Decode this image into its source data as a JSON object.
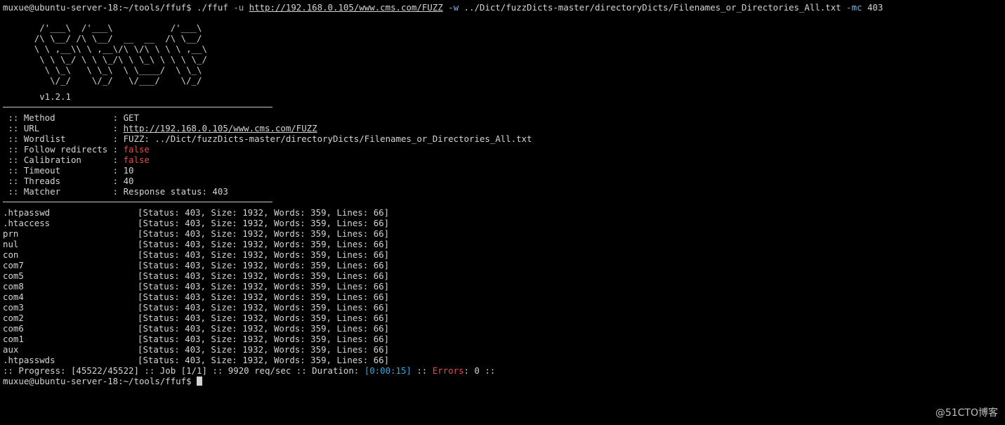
{
  "command": {
    "prompt": "muxue@ubuntu-server-18:~/tools/ffuf$",
    "exe": "./ffuf",
    "flag_u": "-u",
    "url": "http://192.168.0.105/www.cms.com/FUZZ",
    "flag_w": "-w",
    "wordlist": "../Dict/fuzzDicts-master/directoryDicts/Filenames_or_Directories_All.txt",
    "flag_mc": "-mc",
    "mc_value": "403"
  },
  "banner": {
    "art": [
      "       /'___\\  /'___\\           /'___\\",
      "      /\\ \\__/ /\\ \\__/  __  __  /\\ \\__/",
      "      \\ \\ ,__\\\\ \\ ,__\\/\\ \\/\\ \\ \\ \\ ,__\\",
      "       \\ \\ \\_/ \\ \\ \\_/\\ \\ \\_\\ \\ \\ \\ \\_/",
      "        \\ \\_\\   \\ \\_\\  \\ \\____/  \\ \\_\\",
      "         \\/_/    \\/_/   \\/___/    \\/_/"
    ],
    "version": "v1.2.1"
  },
  "config": [
    {
      "key": " :: Method           : ",
      "value": "GET",
      "style": "plain"
    },
    {
      "key": " :: URL              : ",
      "value": "http://192.168.0.105/www.cms.com/FUZZ",
      "style": "underline"
    },
    {
      "key": " :: Wordlist         : ",
      "value": "FUZZ: ../Dict/fuzzDicts-master/directoryDicts/Filenames_or_Directories_All.txt",
      "style": "plain"
    },
    {
      "key": " :: Follow redirects : ",
      "value": "false",
      "style": "red"
    },
    {
      "key": " :: Calibration      : ",
      "value": "false",
      "style": "red"
    },
    {
      "key": " :: Timeout          : ",
      "value": "10",
      "style": "plain"
    },
    {
      "key": " :: Threads          : ",
      "value": "40",
      "style": "plain"
    },
    {
      "key": " :: Matcher          : ",
      "value": "Response status: 403",
      "style": "plain"
    }
  ],
  "results": [
    {
      "word": ".htpasswd",
      "info": "[Status: 403, Size: 1932, Words: 359, Lines: 66]"
    },
    {
      "word": ".htaccess",
      "info": "[Status: 403, Size: 1932, Words: 359, Lines: 66]"
    },
    {
      "word": "prn",
      "info": "[Status: 403, Size: 1932, Words: 359, Lines: 66]"
    },
    {
      "word": "nul",
      "info": "[Status: 403, Size: 1932, Words: 359, Lines: 66]"
    },
    {
      "word": "con",
      "info": "[Status: 403, Size: 1932, Words: 359, Lines: 66]"
    },
    {
      "word": "com7",
      "info": "[Status: 403, Size: 1932, Words: 359, Lines: 66]"
    },
    {
      "word": "com5",
      "info": "[Status: 403, Size: 1932, Words: 359, Lines: 66]"
    },
    {
      "word": "com8",
      "info": "[Status: 403, Size: 1932, Words: 359, Lines: 66]"
    },
    {
      "word": "com4",
      "info": "[Status: 403, Size: 1932, Words: 359, Lines: 66]"
    },
    {
      "word": "com3",
      "info": "[Status: 403, Size: 1932, Words: 359, Lines: 66]"
    },
    {
      "word": "com2",
      "info": "[Status: 403, Size: 1932, Words: 359, Lines: 66]"
    },
    {
      "word": "com6",
      "info": "[Status: 403, Size: 1932, Words: 359, Lines: 66]"
    },
    {
      "word": "com1",
      "info": "[Status: 403, Size: 1932, Words: 359, Lines: 66]"
    },
    {
      "word": "aux",
      "info": "[Status: 403, Size: 1932, Words: 359, Lines: 66]"
    },
    {
      "word": ".htpasswds",
      "info": "[Status: 403, Size: 1932, Words: 359, Lines: 66]"
    }
  ],
  "progress": {
    "prefix": ":: Progress: [45522/45522] :: Job [1/1] :: 9920 req/sec :: Duration: ",
    "duration": "[0:00:15]",
    "mid": " :: ",
    "errors_label": "Errors",
    "suffix": ": 0 ::"
  },
  "final_prompt": "muxue@ubuntu-server-18:~/tools/ffuf$",
  "watermark": "@51CTO博客",
  "colors": {
    "flag": "#7fb2e5",
    "false_value": "#e84a4a",
    "duration": "#3aa6d9"
  }
}
